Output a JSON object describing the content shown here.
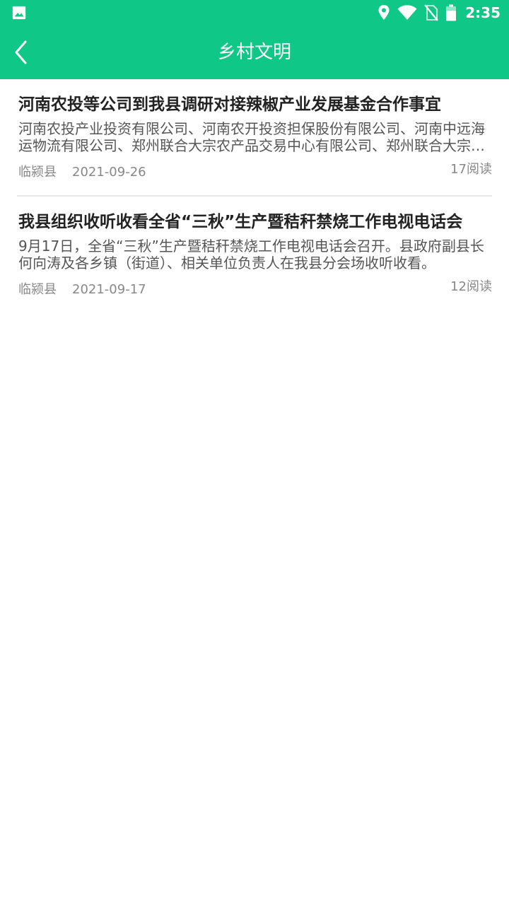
{
  "status_bar": {
    "time": "2:35",
    "icons": [
      "image-icon",
      "location-icon",
      "wifi-icon",
      "no-sim-icon",
      "battery-icon"
    ]
  },
  "header": {
    "title": "乡村文明",
    "back_icon": "chevron-left-icon"
  },
  "colors": {
    "primary": "#0fc787",
    "title_text": "#222222",
    "summary_text": "#555555",
    "meta_text": "#888888"
  },
  "articles": [
    {
      "title": "河南农投等公司到我县调研对接辣椒产业发展基金合作事宜",
      "summary": "河南农投产业投资有限公司、河南农开投资担保股份有限公司、河南中远海运物流有限公司、郑州联合大宗农产品交易中心有限公司、郑州联合大宗…",
      "source": "临颍县",
      "date": "2021-09-26",
      "reads": "17阅读"
    },
    {
      "title": "我县组织收听收看全省“三秋”生产暨秸秆禁烧工作电视电话会",
      "summary": "9月17日，全省“三秋”生产暨秸秆禁烧工作电视电话会召开。县政府副县长何向涛及各乡镇（街道）、相关单位负责人在我县分会场收听收看。",
      "source": "临颍县",
      "date": "2021-09-17",
      "reads": "12阅读"
    }
  ]
}
